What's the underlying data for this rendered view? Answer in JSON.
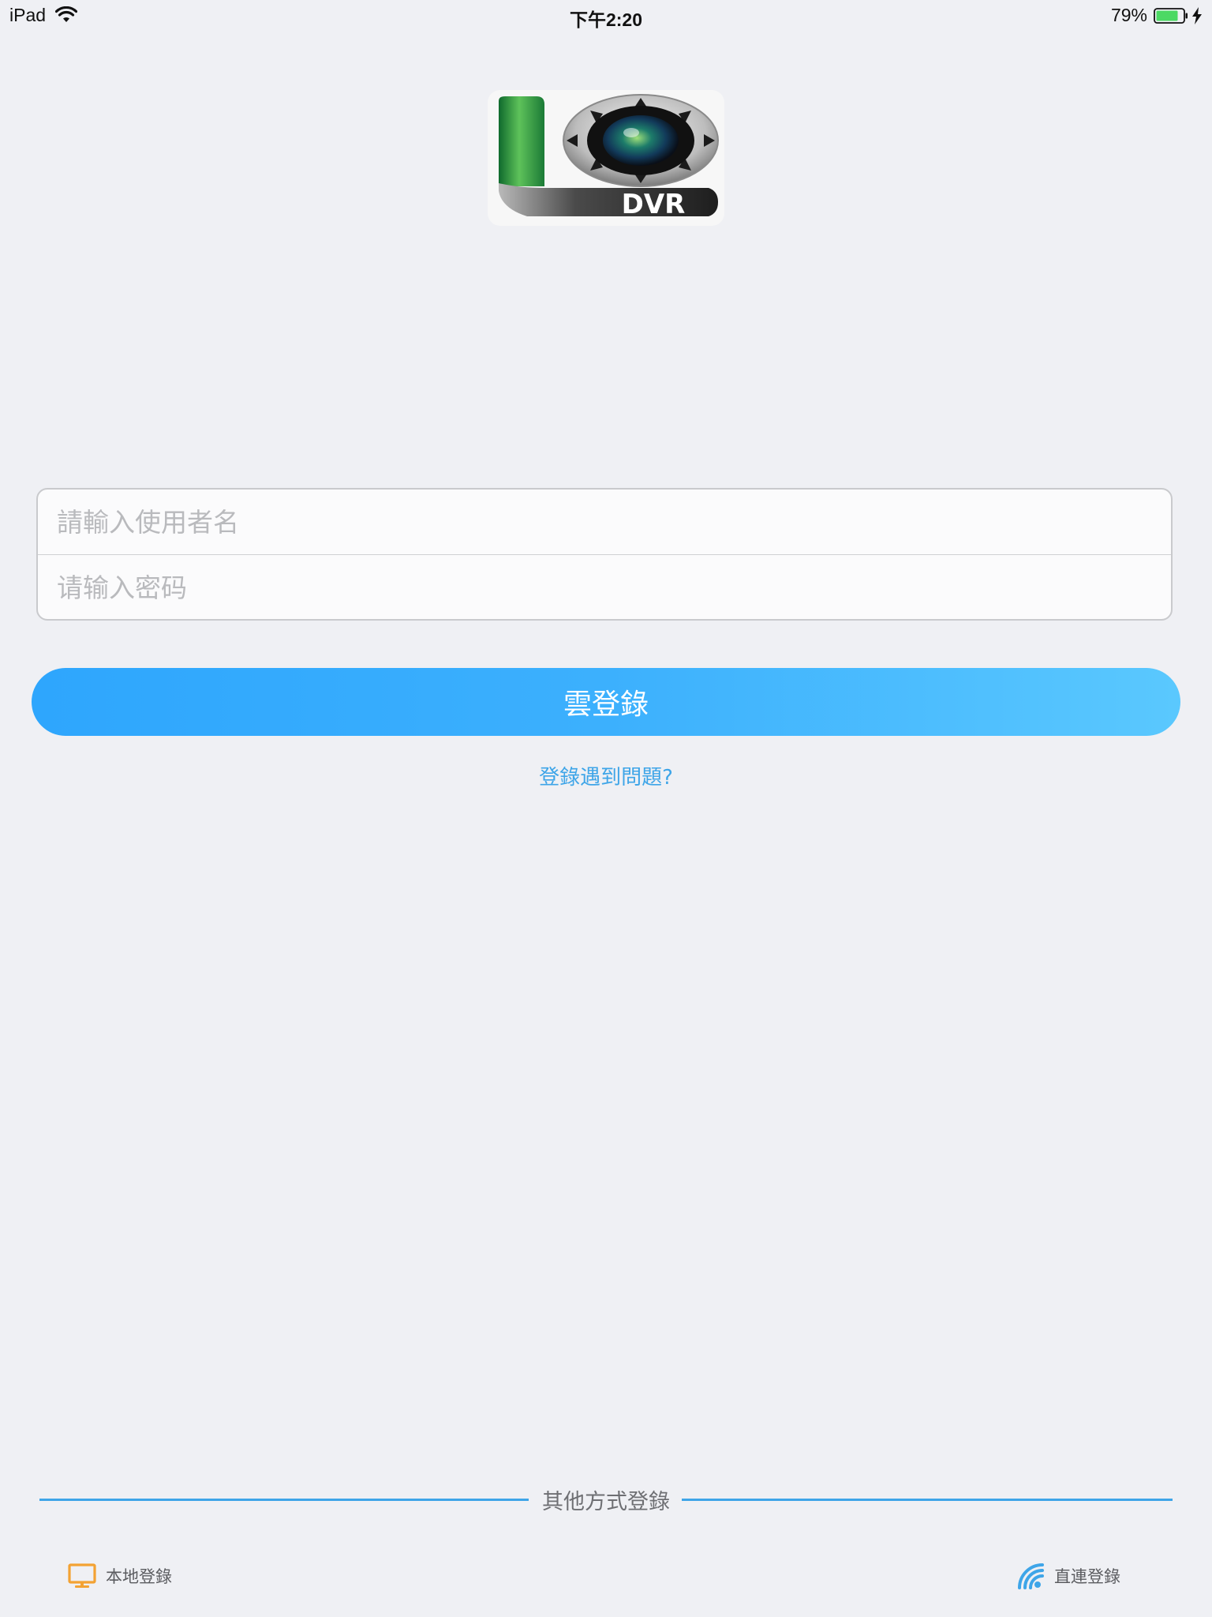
{
  "status_bar": {
    "device": "iPad",
    "time": "下午2:20",
    "battery_percent": "79%"
  },
  "colors": {
    "accent": "#3ea5e8",
    "button_gradient_start": "#2ea6fd",
    "button_gradient_end": "#5ac8fe",
    "local_icon": "#f3a233",
    "background": "#eff0f4"
  },
  "logo": {
    "text": "DVR"
  },
  "form": {
    "username_placeholder": "請輸入使用者名",
    "password_placeholder": "请输入密码"
  },
  "login_button": {
    "label": "雲登錄"
  },
  "help_link": {
    "label": "登錄遇到問題?"
  },
  "other_methods": {
    "label": "其他方式登錄",
    "local": {
      "label": "本地登錄",
      "icon": "monitor-icon"
    },
    "direct": {
      "label": "直連登錄",
      "icon": "wifi-signal-icon"
    }
  }
}
